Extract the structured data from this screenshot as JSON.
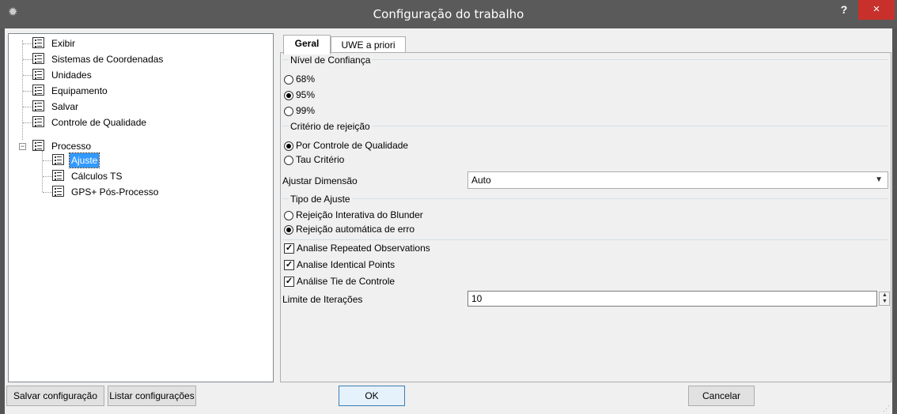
{
  "window": {
    "title": "Configuração do trabalho",
    "help_label": "?",
    "close_label": "×",
    "app_icon": "gear-icon"
  },
  "tree": {
    "items": [
      {
        "label": "Exibir"
      },
      {
        "label": "Sistemas de Coordenadas"
      },
      {
        "label": "Unidades"
      },
      {
        "label": "Equipamento"
      },
      {
        "label": "Salvar"
      },
      {
        "label": "Controle de Qualidade"
      },
      {
        "label": "Processo",
        "expanded": true
      },
      {
        "label": "Ajuste",
        "selected": true
      },
      {
        "label": "Cálculos TS"
      },
      {
        "label": "GPS+ Pós-Processo"
      }
    ]
  },
  "tabs": [
    {
      "label": "Geral",
      "active": true
    },
    {
      "label": "UWE a priori",
      "active": false
    }
  ],
  "confidence": {
    "title": "Nível de Confiança",
    "options": [
      {
        "label": "68%",
        "selected": false
      },
      {
        "label": "95%",
        "selected": true
      },
      {
        "label": "99%",
        "selected": false
      }
    ]
  },
  "rejection": {
    "title": "Critério de rejeição",
    "options": [
      {
        "label": "Por Controle de Qualidade",
        "selected": true
      },
      {
        "label": "Tau Critério",
        "selected": false
      }
    ]
  },
  "dimension": {
    "label": "Ajustar Dimensão",
    "value": "Auto"
  },
  "adjust_type": {
    "title": "Tipo de Ajuste",
    "options": [
      {
        "label": "Rejeição Interativa do Blunder",
        "selected": false
      },
      {
        "label": "Rejeição automática de erro",
        "selected": true
      }
    ]
  },
  "checks": [
    {
      "label": "Analise Repeated Observations",
      "checked": true
    },
    {
      "label": "Analise Identical Points",
      "checked": true
    },
    {
      "label": "Análise Tie de Controle",
      "checked": true
    }
  ],
  "iterations": {
    "label": "Limite de Iterações",
    "value": "10"
  },
  "buttons": {
    "save_config": "Salvar configuração",
    "list_configs": "Listar configurações",
    "ok": "OK",
    "cancel": "Cancelar"
  },
  "colors": {
    "titlebar": "#5a5a5a",
    "close": "#c7302b",
    "selection": "#3399ff"
  }
}
